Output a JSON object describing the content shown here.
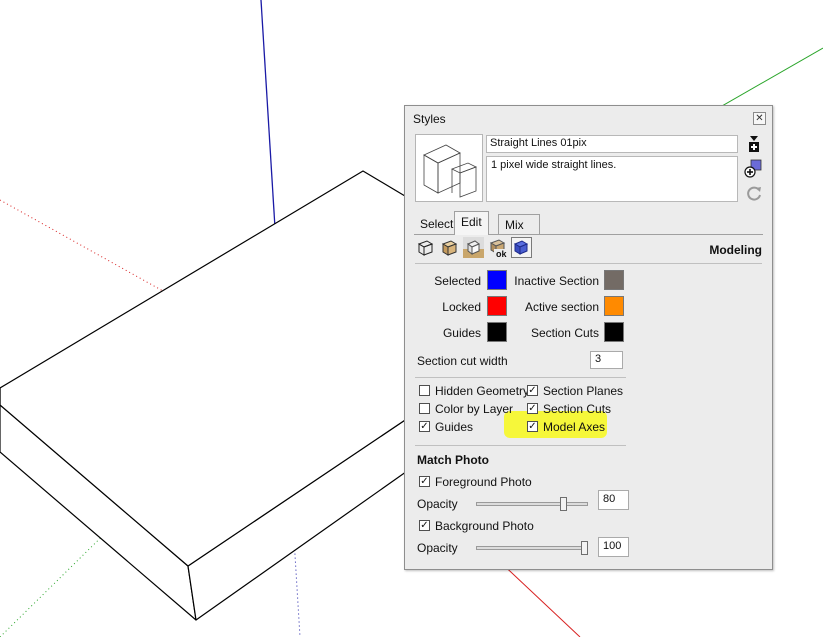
{
  "dialog": {
    "title": "Styles",
    "close_glyph": "✕",
    "style_name": "Straight Lines 01pix",
    "style_description": "1 pixel wide straight lines.",
    "side_icons": [
      "create-new-style-icon",
      "update-style-icon",
      "refresh-icon"
    ]
  },
  "tabs": [
    {
      "label": "Select"
    },
    {
      "label": "Edit"
    },
    {
      "label": "Mix"
    }
  ],
  "active_tab": "Edit",
  "category_icons": [
    "edge-settings-icon",
    "face-settings-icon",
    "background-settings-icon",
    "watermark-settings-icon",
    "modeling-settings-icon"
  ],
  "category_label": "Modeling",
  "colors": {
    "selected": {
      "label": "Selected",
      "color": "#0000ff"
    },
    "locked": {
      "label": "Locked",
      "color": "#ff0000"
    },
    "guides": {
      "label": "Guides",
      "color": "#000000"
    },
    "inactive_section": {
      "label": "Inactive Section",
      "color": "#736b65"
    },
    "active_section": {
      "label": "Active section",
      "color": "#ff8a00"
    },
    "section_cuts": {
      "label": "Section Cuts",
      "color": "#000000"
    }
  },
  "section_cut_width": {
    "label": "Section cut width",
    "value": "3"
  },
  "checkboxes": {
    "hidden_geometry": {
      "label": "Hidden Geometry",
      "checked": false
    },
    "color_by_layer": {
      "label": "Color by Layer",
      "checked": false
    },
    "guides": {
      "label": "Guides",
      "checked": true
    },
    "section_planes": {
      "label": "Section Planes",
      "checked": true
    },
    "section_cuts": {
      "label": "Section Cuts",
      "checked": true
    },
    "model_axes": {
      "label": "Model Axes",
      "checked": true
    }
  },
  "match_photo": {
    "heading": "Match Photo",
    "foreground": {
      "label": "Foreground Photo",
      "checked": true,
      "opacity_label": "Opacity",
      "opacity": "80"
    },
    "background": {
      "label": "Background Photo",
      "checked": true,
      "opacity_label": "Opacity",
      "opacity": "100"
    }
  },
  "check_glyph": "✓",
  "highlight_color": "#f6f73a"
}
